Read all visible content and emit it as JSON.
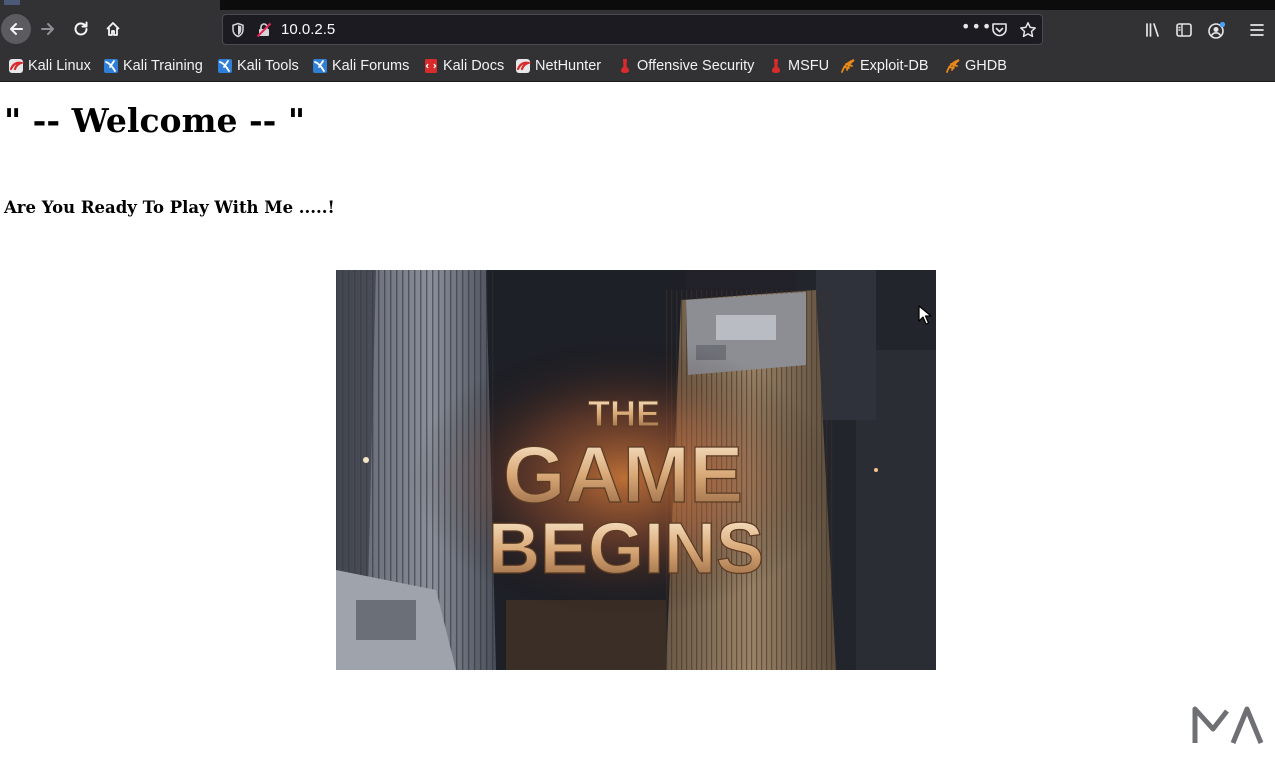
{
  "browser": {
    "url": "10.0.2.5",
    "more_glyph": "•••"
  },
  "bookmarks": [
    {
      "label": "Kali Linux",
      "icon": "kali-dragon-icon"
    },
    {
      "label": "Kali Training",
      "icon": "kali-training-icon"
    },
    {
      "label": "Kali Tools",
      "icon": "kali-tools-icon"
    },
    {
      "label": "Kali Forums",
      "icon": "kali-forums-icon"
    },
    {
      "label": "Kali Docs",
      "icon": "kali-docs-icon"
    },
    {
      "label": "NetHunter",
      "icon": "kali-dragon-icon"
    },
    {
      "label": "Offensive Security",
      "icon": "offsec-icon"
    },
    {
      "label": "MSFU",
      "icon": "offsec-icon"
    },
    {
      "label": "Exploit-DB",
      "icon": "exploitdb-icon"
    },
    {
      "label": "GHDB",
      "icon": "exploitdb-icon"
    }
  ],
  "page": {
    "heading": "\" -- Welcome -- \"",
    "subheading": "Are You Ready To Play With Me .....!",
    "image": {
      "line1": "THE",
      "line2": "GAME",
      "line3": "BEGINS"
    }
  },
  "colors": {
    "chrome": "#323234",
    "urlbar": "#1c1b22",
    "kali_red": "#d92b2b",
    "kali_blue": "#2f7fd8",
    "exploitdb_orange": "#e9891a"
  }
}
